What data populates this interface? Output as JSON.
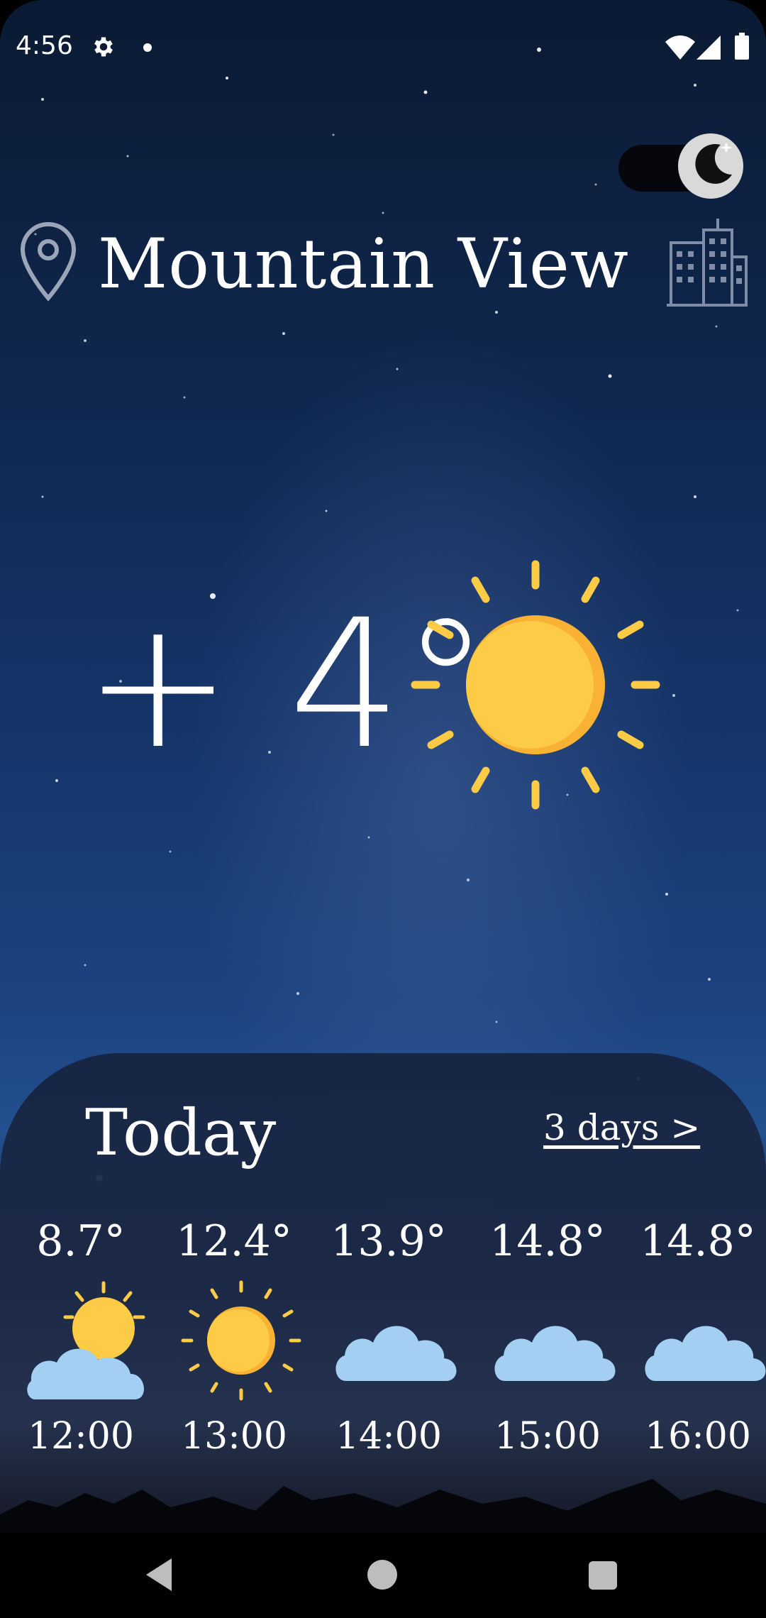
{
  "status_bar": {
    "time": "4:56"
  },
  "header": {
    "city": "Mountain View",
    "theme_toggle": "dark"
  },
  "current": {
    "temperature": "+ 4°",
    "condition_icon": "sun-icon"
  },
  "forecast": {
    "title": "Today",
    "more_link": "3 days >",
    "hours": [
      {
        "temp": "8.7°",
        "time": "12:00",
        "icon": "partly-cloudy-icon"
      },
      {
        "temp": "12.4°",
        "time": "13:00",
        "icon": "sun-icon"
      },
      {
        "temp": "13.9°",
        "time": "14:00",
        "icon": "cloud-icon"
      },
      {
        "temp": "14.8°",
        "time": "15:00",
        "icon": "cloud-icon"
      },
      {
        "temp": "14.8°",
        "time": "16:00",
        "icon": "cloud-icon"
      }
    ]
  },
  "colors": {
    "sun": "#fdcb45",
    "sun_shade": "#f9b233",
    "cloud": "#a3cff3"
  }
}
